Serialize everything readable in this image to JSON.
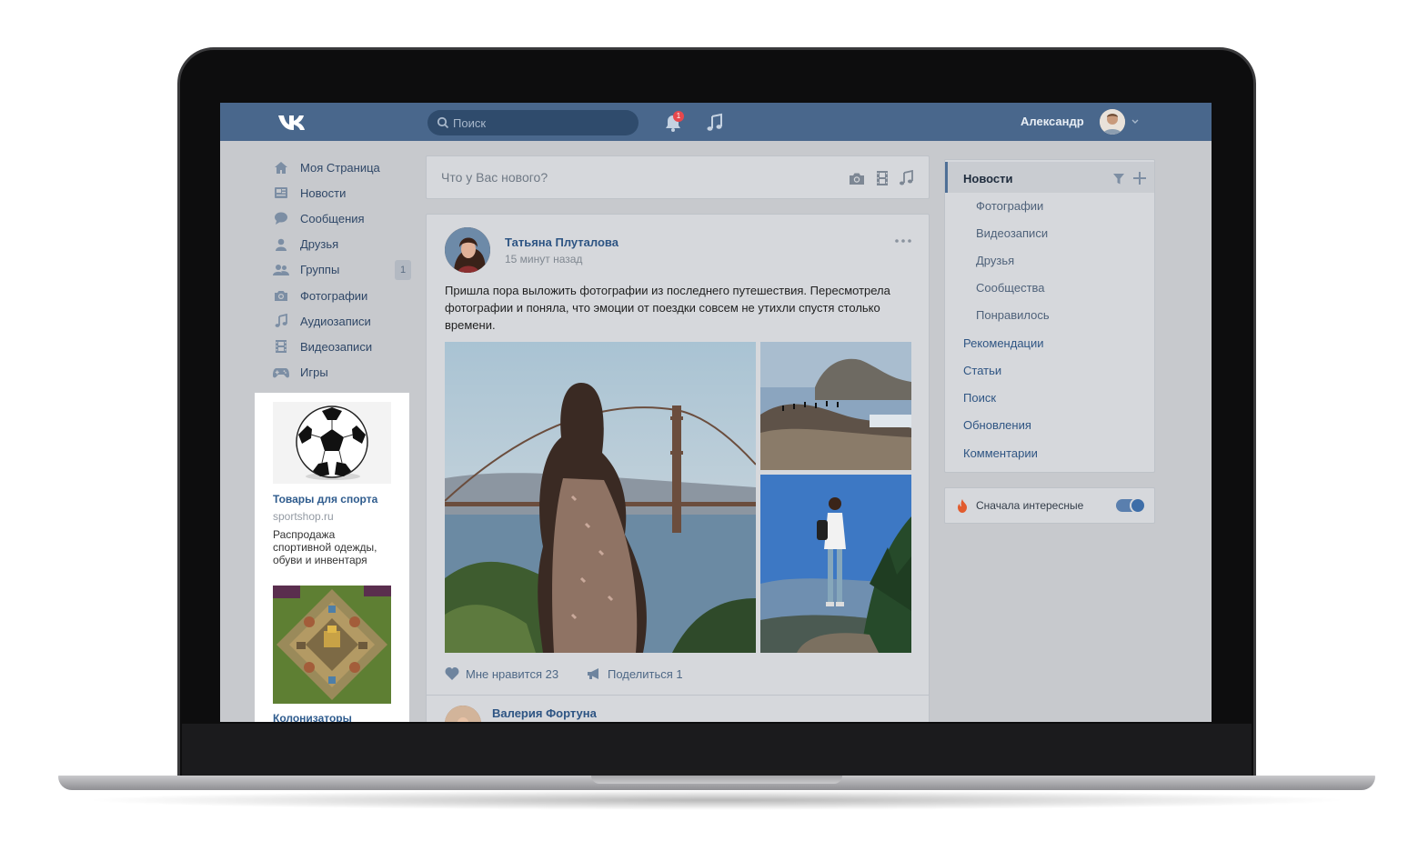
{
  "header": {
    "search_placeholder": "Поиск",
    "notification_count": "1",
    "user_name": "Александр"
  },
  "nav": {
    "items": [
      {
        "label": "Моя Страница",
        "icon": "home-icon"
      },
      {
        "label": "Новости",
        "icon": "news-icon"
      },
      {
        "label": "Сообщения",
        "icon": "messages-icon"
      },
      {
        "label": "Друзья",
        "icon": "friends-icon"
      },
      {
        "label": "Группы",
        "icon": "groups-icon",
        "count": "1"
      },
      {
        "label": "Фотографии",
        "icon": "camera-icon"
      },
      {
        "label": "Аудиозаписи",
        "icon": "music-icon"
      },
      {
        "label": "Видеозаписи",
        "icon": "video-icon"
      },
      {
        "label": "Игры",
        "icon": "gamepad-icon"
      }
    ]
  },
  "ads": [
    {
      "title": "Товары для спорта",
      "domain": "sportshop.ru",
      "description": "Распродажа спортивной одежды, обуви и инвентаря"
    },
    {
      "title": "Колонизаторы"
    }
  ],
  "composer": {
    "placeholder": "Что у Вас нового?"
  },
  "post": {
    "author": "Татьяна Плуталова",
    "time": "15 минут назад",
    "text": "Пришла пора выложить фотографии из последнего путешествия. Пересмотрела фотографии и поняла, что эмоции от поездки совсем не утихли спустя столько времени.",
    "like_label": "Мне нравится 23",
    "share_label": "Поделиться 1"
  },
  "next_post": {
    "author": "Валерия Фортуна"
  },
  "right_menu": {
    "header": "Новости",
    "subitems": [
      "Фотографии",
      "Видеозаписи",
      "Друзья",
      "Сообщества",
      "Понравилось"
    ],
    "items": [
      "Рекомендации",
      "Статьи",
      "Поиск",
      "Обновления",
      "Комментарии"
    ]
  },
  "toggle": {
    "label": "Сначала интересные",
    "on": true
  },
  "colors": {
    "header": "#49678c",
    "link": "#2d5483",
    "screen_bg": "#c7c9cd"
  }
}
